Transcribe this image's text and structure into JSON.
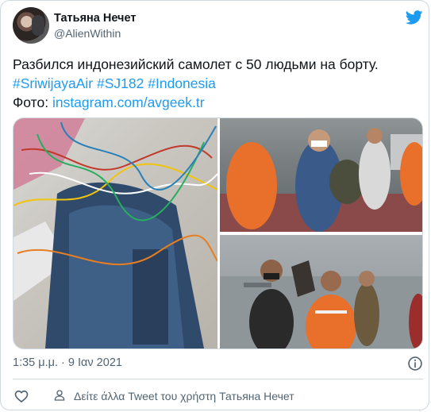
{
  "author": {
    "name": "Татьяна Нечет",
    "handle": "@AlienWithin"
  },
  "tweet": {
    "line1": "Разбился индонезийский самолет с 50 людьми на борту.",
    "hashtags": [
      "#SriwijayaAir",
      "#SJ182",
      "#Indonesia"
    ],
    "photo_label": "Фото:",
    "photo_link": "instagram.com/avgeek.tr"
  },
  "footer": {
    "timestamp": "1:35 μ.μ. · 9 Ιαν 2021",
    "more_tweets": "Δείτε άλλα Tweet του χρήστη Татьяна Нечет"
  },
  "icons": {
    "brand": "twitter-bird-icon",
    "info": "info-icon",
    "like": "heart-icon",
    "profile": "user-icon"
  },
  "colors": {
    "brand": "#1d9bf0",
    "secondary_text": "#536471",
    "border": "#cfd9de"
  }
}
